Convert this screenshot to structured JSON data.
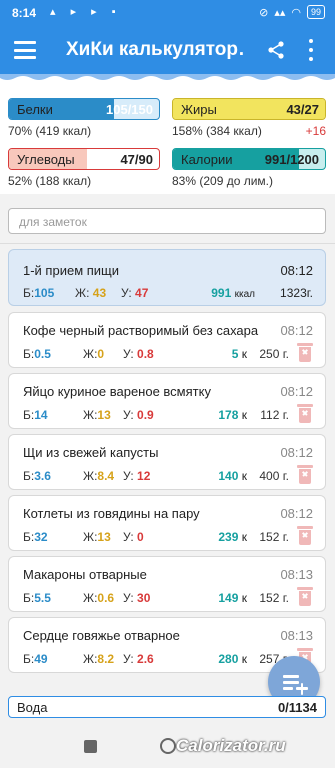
{
  "status_bar": {
    "time": "8:14",
    "battery": "99"
  },
  "app_bar": {
    "title": "ХиКи калькулятор…"
  },
  "macros": {
    "protein": {
      "label": "Белки",
      "value": "105/150",
      "sub": "70% (419 ккал)",
      "progress": 0.7,
      "color": "#2b8cc8"
    },
    "fat": {
      "label": "Жиры",
      "value": "43/27",
      "sub": "158% (384 ккал)",
      "over": "+16",
      "progress": 1.0,
      "color": "#e8d43a"
    },
    "carbs": {
      "label": "Углеводы",
      "value": "47/90",
      "sub": "52% (188 ккал)",
      "progress": 0.52,
      "color": "#e85a5a"
    },
    "calories": {
      "label": "Калории",
      "value": "991/1200",
      "sub": "83% (209 до лим.)",
      "progress": 0.83,
      "color": "#16a0a0"
    }
  },
  "notes": {
    "placeholder": "для заметок"
  },
  "meal": {
    "title": "1-й прием пищи",
    "time": "08:12",
    "p_label": "Б:",
    "p": "105",
    "f_label": "Ж:",
    "f": "43",
    "c_label": "У:",
    "c": "47",
    "kcal": "991",
    "kcal_unit": "ккал",
    "weight": "1323",
    "weight_unit": "г."
  },
  "foods": [
    {
      "name": "Кофе черный растворимый без сахара",
      "time": "08:12",
      "p": "0.5",
      "f": "0",
      "c": "0.8",
      "kcal": "5",
      "weight": "250"
    },
    {
      "name": "Яйцо куриное вареное всмятку",
      "time": "08:12",
      "p": "14",
      "f": "13",
      "c": "0.9",
      "kcal": "178",
      "weight": "112"
    },
    {
      "name": "Щи из свежей капусты",
      "time": "08:12",
      "p": "3.6",
      "f": "8.4",
      "c": "12",
      "kcal": "140",
      "weight": "400"
    },
    {
      "name": "Котлеты из говядины на пару",
      "time": "08:12",
      "p": "32",
      "f": "13",
      "c": "0",
      "kcal": "239",
      "weight": "152"
    },
    {
      "name": "Макароны отварные",
      "time": "08:13",
      "p": "5.5",
      "f": "0.6",
      "c": "30",
      "kcal": "149",
      "weight": "152"
    },
    {
      "name": "Сердце говяжье отварное",
      "time": "08:13",
      "p": "49",
      "f": "8.2",
      "c": "2.6",
      "kcal": "280",
      "weight": "257"
    }
  ],
  "labels": {
    "p": "Б:",
    "f": "Ж:",
    "c": "У:",
    "kcal_unit": "к",
    "weight_unit": "г."
  },
  "water": {
    "label": "Вода",
    "value": "0/1134"
  },
  "watermark": "Calorizator.ru"
}
